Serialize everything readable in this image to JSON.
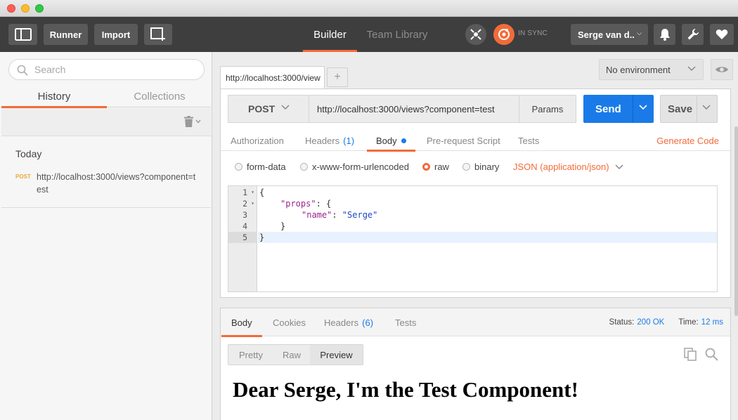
{
  "toolbar": {
    "runner_label": "Runner",
    "import_label": "Import",
    "builder_tab": "Builder",
    "team_library_tab": "Team Library",
    "sync_status": "IN SYNC",
    "user_name": "Serge van d.."
  },
  "sidebar": {
    "search_placeholder": "Search",
    "tabs": [
      {
        "label": "History",
        "active": true
      },
      {
        "label": "Collections",
        "active": false
      }
    ],
    "group_label": "Today",
    "history": [
      {
        "method": "POST",
        "url": "http://localhost:3000/views?component=test"
      }
    ]
  },
  "request": {
    "tab_label": "http://localhost:3000/view",
    "environment": "No environment",
    "method": "POST",
    "url": "http://localhost:3000/views?component=test",
    "params_label": "Params",
    "send_label": "Send",
    "save_label": "Save",
    "sub_tabs": {
      "authorization": "Authorization",
      "headers": "Headers",
      "headers_count": "(1)",
      "body": "Body",
      "prerequest": "Pre-request Script",
      "tests": "Tests"
    },
    "generate_code": "Generate Code",
    "body_modes": [
      "form-data",
      "x-www-form-urlencoded",
      "raw",
      "binary"
    ],
    "selected_mode": "raw",
    "content_type": "JSON (application/json)",
    "code": {
      "line_numbers": [
        "1",
        "2",
        "3",
        "4",
        "5"
      ],
      "open_brace": "{",
      "props_key": "\"props\"",
      "colon_open": ": {",
      "name_key": "\"name\"",
      "colon": ": ",
      "name_value": "\"Serge\"",
      "inner_close": "}",
      "outer_close": "}"
    }
  },
  "response": {
    "tabs": {
      "body": "Body",
      "cookies": "Cookies",
      "headers": "Headers",
      "headers_count": "(6)",
      "tests": "Tests"
    },
    "status_label": "Status:",
    "status_value": "200 OK",
    "time_label": "Time:",
    "time_value": "12 ms",
    "view_modes": [
      "Pretty",
      "Raw",
      "Preview"
    ],
    "active_view": "Preview",
    "preview_text": "Dear Serge, I'm the Test Component!"
  },
  "colors": {
    "accent": "#f26b3a",
    "send_blue": "#1a7be8",
    "toolbar_bg": "#3e3e3e"
  }
}
